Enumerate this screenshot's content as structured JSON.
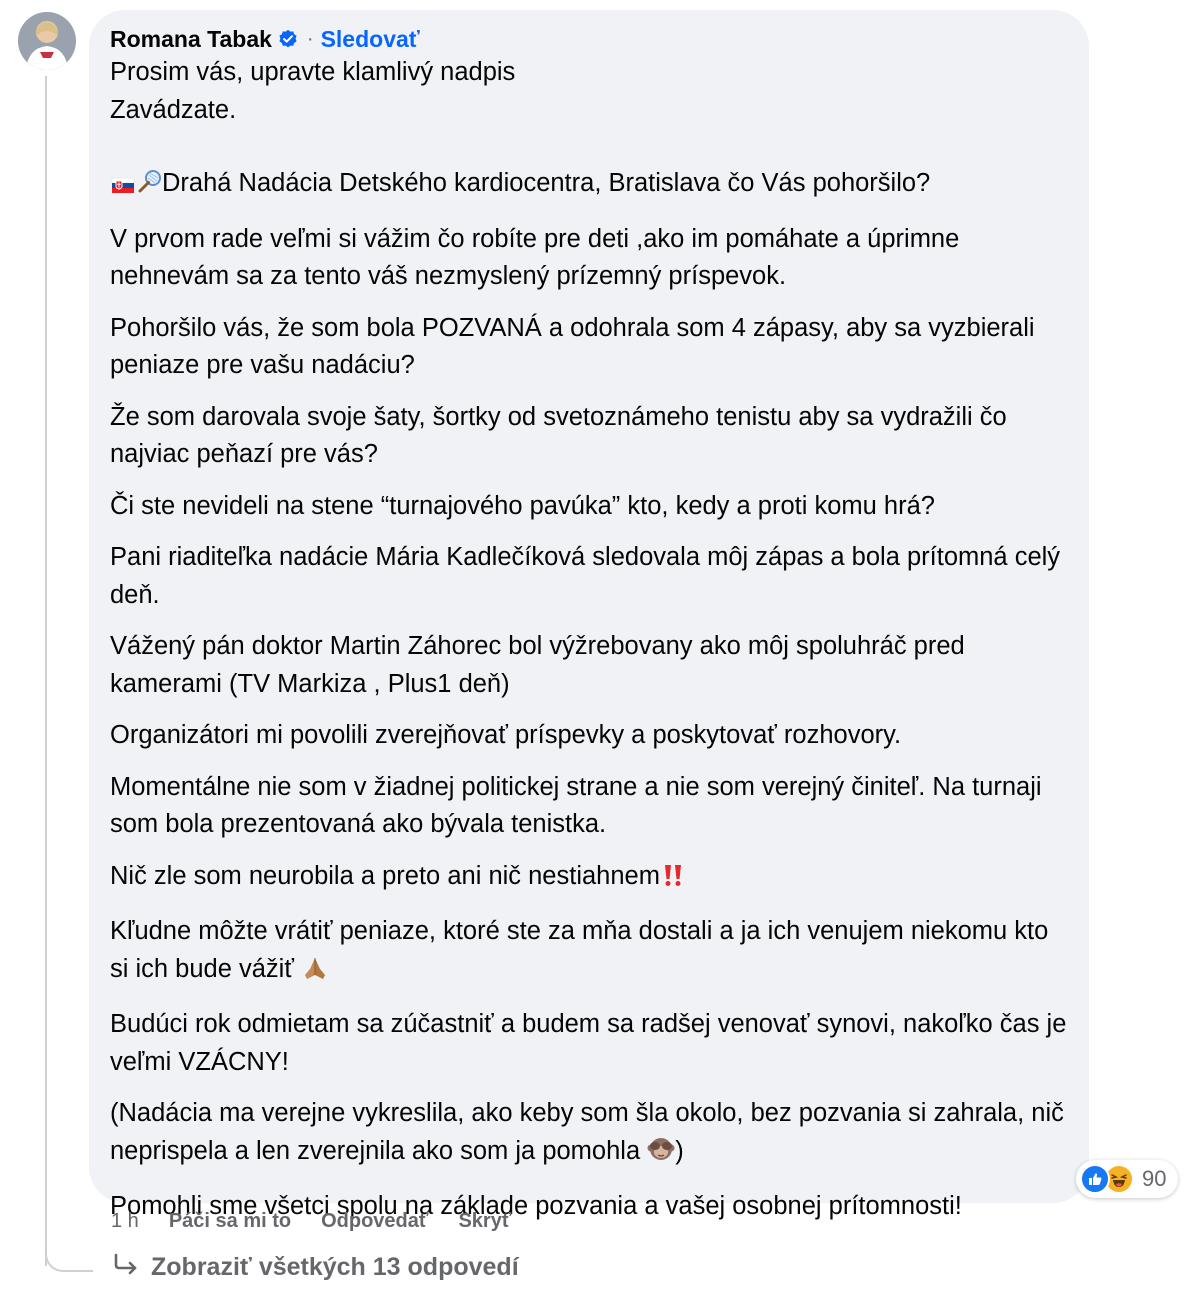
{
  "comment": {
    "author": "Romana Tabak",
    "verified_icon": "verified-badge-icon",
    "separator": "·",
    "follow_label": "Sledovať",
    "paragraphs": [
      "Prosim vás, upravte klamlivý nadpis",
      "Zavádzate.",
      "Drahá Nadácia Detského kardiocentra, Bratislava čo Vás pohoršilo?",
      "V prvom rade veľmi si vážim čo robíte pre deti ,ako im pomáhate a úprimne nehnevám sa za tento váš nezmyslený prízemný príspevok.",
      "Pohoršilo vás, že som bola POZVANÁ a odohrala som 4 zápasy, aby sa vyzbierali peniaze pre vašu nadáciu?",
      "Že som darovala svoje šaty, šortky od svetoznámeho tenistu aby sa vydražili čo najviac peňazí pre vás?",
      "Či ste nevideli na stene “turnajového pavúka” kto, kedy a proti komu hrá?",
      "Pani riaditeľka nadácie Mária Kadlečíková sledovala môj zápas a bola prítomná celý deň.",
      "Vážený pán doktor Martin Záhorec bol výžrebovany ako môj spoluhráč pred kamerami (TV Markiza , Plus1 deň)",
      "Organizátori mi povolili zverejňovať príspevky a poskytovať rozhovory.",
      "Momentálne nie som v žiadnej politickej strane a nie som verejný činiteľ. Na turnaji som bola prezentovaná ako bývala tenistka.",
      "Nič zle som neurobila a preto ani nič nestiahnem",
      "Kľudne môžte vrátiť peniaze, ktoré ste za mňa dostali a ja ich venujem niekomu kto si ich bude vážiť",
      "Budúci rok odmietam sa zúčastniť a budem sa radšej venovať synovi, nakoľko čas je veľmi VZÁCNY!",
      "(Nadácia ma verejne vykreslila, ako keby som šla okolo, bez pozvania si zahrala, nič neprispela a len zverejnila ako som ja pomohla",
      ")",
      "Pomohli sme všetci spolu na základe pozvania a vašej osobnej prítomnosti!"
    ],
    "emojis": {
      "flag": "slovakia-flag-icon",
      "racket": "tennis-racket-icon",
      "exclamation": "double-exclamation-icon",
      "pray": "folded-hands-icon",
      "monkey": "see-no-evil-monkey-icon"
    }
  },
  "reactions": {
    "icons": [
      "like-reaction-icon",
      "haha-reaction-icon"
    ],
    "count": "90",
    "colors": {
      "like": "#1877f2",
      "haha": "#f7b125"
    }
  },
  "actions": {
    "time": "1 h",
    "like_label": "Páči sa mi to",
    "reply_label": "Odpovedať",
    "hide_label": "Skryť"
  },
  "replies": {
    "arrow_icon": "reply-arrow-icon",
    "label": "Zobraziť všetkých 13 odpovedí"
  },
  "colors": {
    "bubble": "#f0f2f5",
    "link": "#0866ff",
    "secondary_text": "#65676b",
    "thread_line": "#ced0d4"
  }
}
